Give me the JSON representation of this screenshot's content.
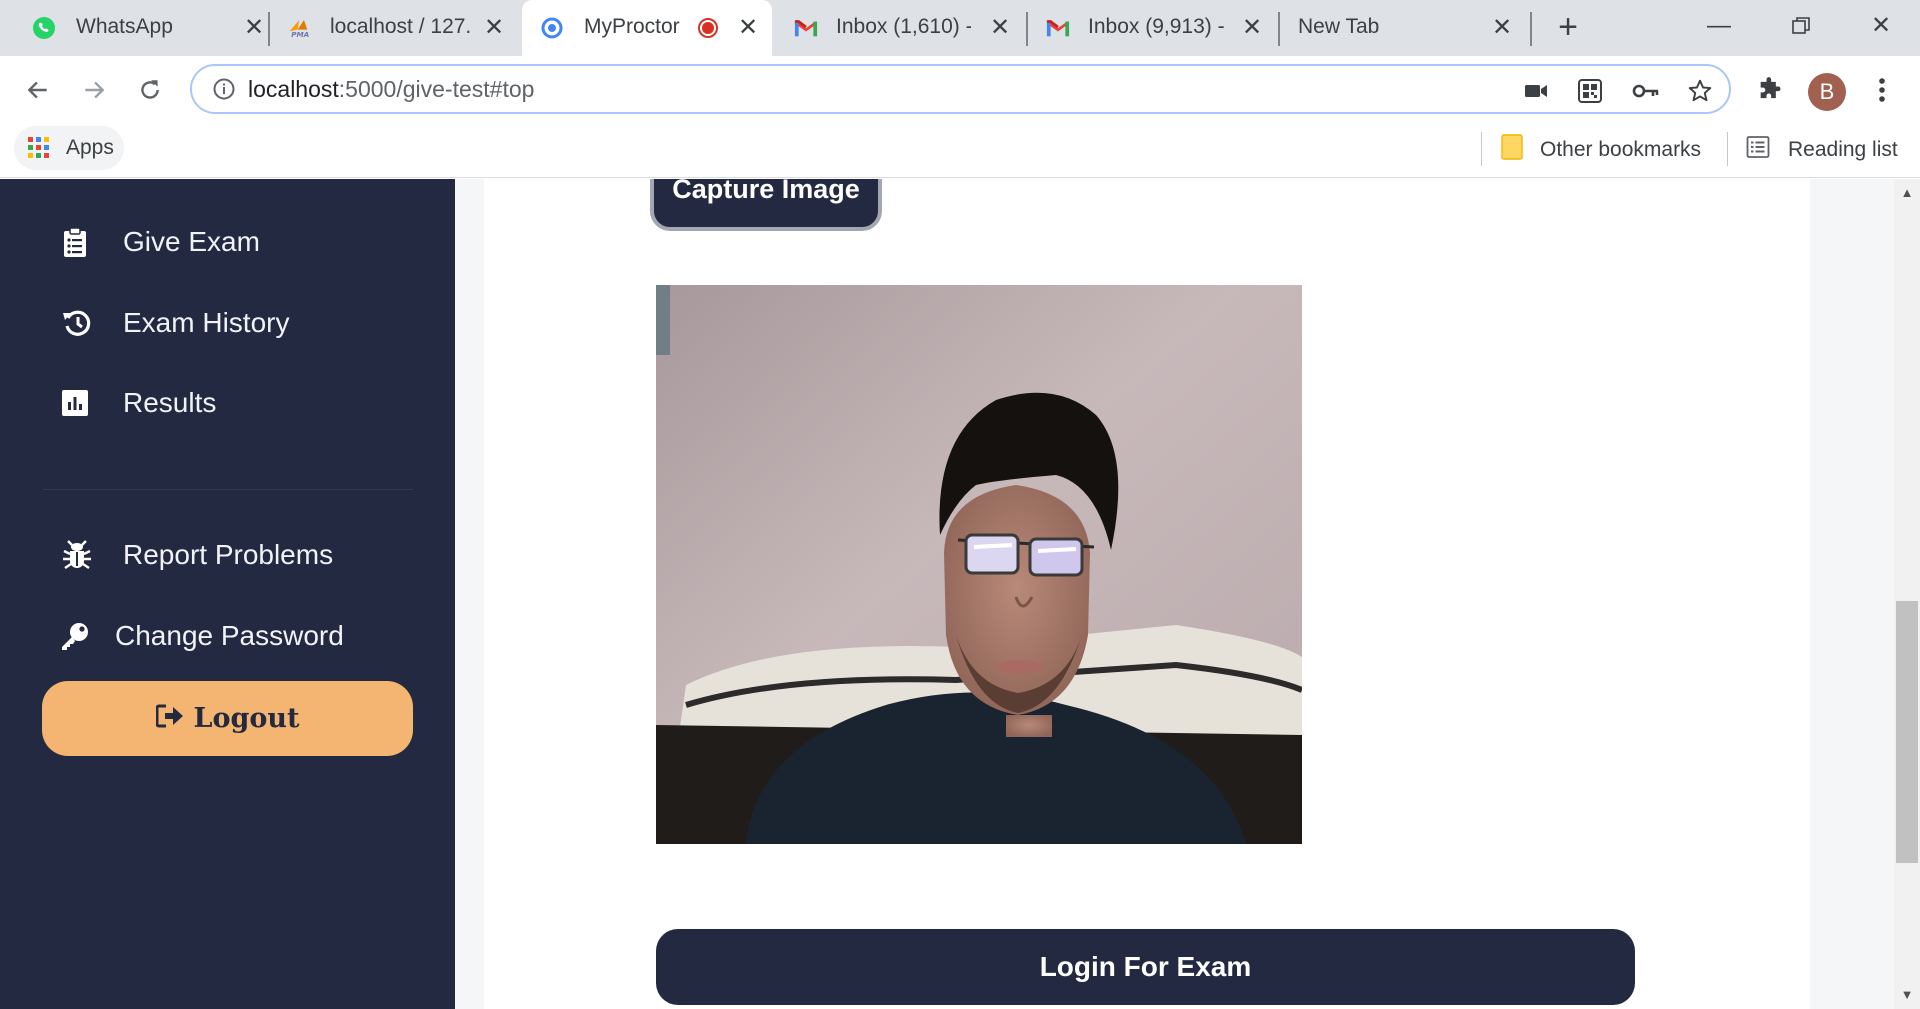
{
  "browser": {
    "tabs": [
      {
        "title": "WhatsApp",
        "icon": "whatsapp-icon",
        "active": false
      },
      {
        "title": "localhost / 127.",
        "icon": "phpmyadmin-icon",
        "active": false
      },
      {
        "title": "MyProctor",
        "icon": "chrome-icon",
        "active": true,
        "recording": true
      },
      {
        "title": "Inbox (1,610) -",
        "icon": "gmail-icon",
        "active": false
      },
      {
        "title": "Inbox (9,913) -",
        "icon": "gmail-icon",
        "active": false
      },
      {
        "title": "New Tab",
        "icon": "",
        "active": false
      }
    ],
    "url_host": "localhost",
    "url_rest": ":5000/give-test#top",
    "profile_initial": "B"
  },
  "bookmarks": {
    "apps_label": "Apps",
    "other_label": "Other bookmarks",
    "reading_label": "Reading list"
  },
  "sidebar": {
    "items": [
      {
        "label": "Give Exam",
        "icon": "clipboard-list-icon"
      },
      {
        "label": "Exam History",
        "icon": "history-icon"
      },
      {
        "label": "Results",
        "icon": "chart-bar-icon"
      },
      {
        "label": "Report Problems",
        "icon": "bug-icon"
      },
      {
        "label": "Change Password",
        "icon": "key-icon"
      }
    ],
    "logout_label": "Logout"
  },
  "main": {
    "capture_label": "Capture Image",
    "login_label": "Login For Exam"
  },
  "colors": {
    "sidebar_bg": "#232940",
    "logout_bg": "#f3b571",
    "button_bg": "#232940"
  }
}
